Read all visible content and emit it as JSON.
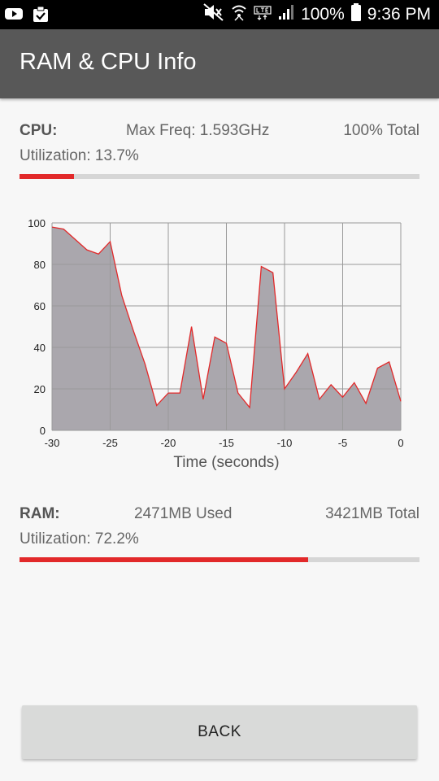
{
  "status_bar": {
    "battery_text": "100%",
    "time": "9:36 PM",
    "icons": [
      "youtube-icon",
      "clipboard-check-icon",
      "mute-icon",
      "wifi-icon",
      "lte-icon",
      "signal-icon",
      "battery-icon"
    ]
  },
  "app_bar": {
    "title": "RAM & CPU Info"
  },
  "cpu": {
    "label": "CPU:",
    "max_freq": "Max Freq: 1.593GHz",
    "total": "100% Total",
    "utilization": "Utilization: 13.7%",
    "utilization_fraction": 0.137
  },
  "chart_data": {
    "type": "area",
    "xlabel": "Time (seconds)",
    "ylabel": "",
    "xlim": [
      -30,
      0
    ],
    "ylim": [
      0,
      100
    ],
    "x_ticks": [
      "-30",
      "-25",
      "-20",
      "-15",
      "-10",
      "-5",
      "0"
    ],
    "y_ticks": [
      "0",
      "20",
      "40",
      "60",
      "80",
      "100"
    ],
    "grid": true,
    "x": [
      -30,
      -29,
      -28,
      -27,
      -26,
      -25,
      -24,
      -23,
      -22,
      -21,
      -20,
      -19,
      -18,
      -17,
      -16,
      -15,
      -14,
      -13,
      -12,
      -11,
      -10,
      -9,
      -8,
      -7,
      -6,
      -5,
      -4,
      -3,
      -2,
      -1,
      0
    ],
    "values": [
      98,
      97,
      92,
      87,
      85,
      91,
      65,
      48,
      32,
      12,
      18,
      18,
      50,
      15,
      45,
      42,
      18,
      11,
      79,
      76,
      20,
      28,
      37,
      15,
      22,
      16,
      23,
      13,
      30,
      33,
      14
    ],
    "line_color": "#e2292a",
    "fill_color": "#aaa7ad"
  },
  "ram": {
    "label": "RAM:",
    "used": "2471MB Used",
    "total": "3421MB Total",
    "utilization": "Utilization: 72.2%",
    "utilization_fraction": 0.722
  },
  "back_button": {
    "label": "BACK"
  },
  "colors": {
    "accent": "#e2292a",
    "app_bar": "#585858",
    "track": "#d6d6d6"
  }
}
